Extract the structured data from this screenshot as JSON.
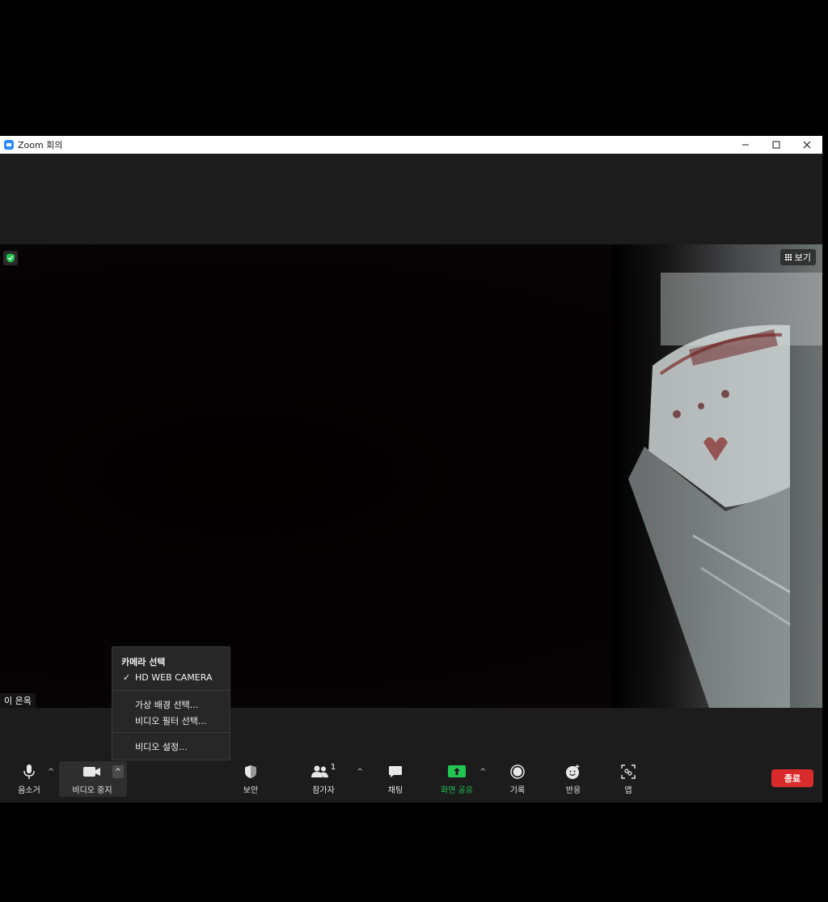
{
  "window": {
    "title": "Zoom 회의"
  },
  "video": {
    "view_label": "보기",
    "participant_name": "이 은옥"
  },
  "toolbar": {
    "mute_label": "음소거",
    "stop_video_label": "비디오 중지",
    "security_label": "보안",
    "participants_label": "참가자",
    "participants_count": "1",
    "chat_label": "채팅",
    "share_screen_label": "화면 공유",
    "record_label": "기록",
    "reactions_label": "반응",
    "apps_label": "앱",
    "end_label": "종료"
  },
  "video_menu": {
    "header": "카메라 선택",
    "camera": "HD WEB CAMERA",
    "virtual_background": "가상 배경 선택...",
    "video_filter": "비디오 필터 선택...",
    "video_settings": "비디오 설정..."
  },
  "colors": {
    "share_green": "#23c552",
    "end_red": "#d92b2b",
    "security_green": "#23c552"
  }
}
